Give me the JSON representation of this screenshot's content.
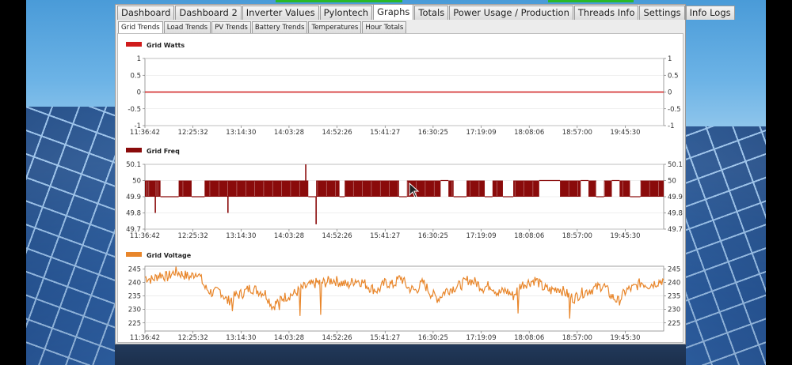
{
  "tabs": [
    {
      "label": "Dashboard",
      "active": false
    },
    {
      "label": "Dashboard 2",
      "active": false
    },
    {
      "label": "Inverter Values",
      "active": false
    },
    {
      "label": "Pylontech",
      "active": false
    },
    {
      "label": "Graphs",
      "active": true
    },
    {
      "label": "Totals",
      "active": false
    },
    {
      "label": "Power Usage / Production",
      "active": false
    },
    {
      "label": "Threads Info",
      "active": false
    },
    {
      "label": "Settings",
      "active": false
    },
    {
      "label": "Info Logs",
      "active": false
    }
  ],
  "subtabs": [
    {
      "label": "Grid Trends",
      "active": true
    },
    {
      "label": "Load Trends",
      "active": false
    },
    {
      "label": "PV Trends",
      "active": false
    },
    {
      "label": "Battery Trends",
      "active": false
    },
    {
      "label": "Temperatures",
      "active": false
    },
    {
      "label": "Hour Totals",
      "active": false
    }
  ],
  "colors": {
    "grid_watts": "#d01c1c",
    "grid_freq": "#8a0b0b",
    "grid_voltage": "#e8862b"
  },
  "chart_data": [
    {
      "type": "line",
      "legend": "Grid Watts",
      "color": "#d01c1c",
      "x_ticks": [
        "11:36:42",
        "12:25:32",
        "13:14:30",
        "14:03:28",
        "14:52:26",
        "15:41:27",
        "16:30:25",
        "17:19:09",
        "18:08:06",
        "18:57:00",
        "19:45:30"
      ],
      "y_ticks": [
        "1",
        "0.5",
        "0",
        "-0.5",
        "-1"
      ],
      "ylim": [
        -1,
        1
      ],
      "series": [
        {
          "name": "Grid Watts",
          "values": [
            0,
            0,
            0,
            0,
            0,
            0,
            0,
            0,
            0,
            0,
            0
          ]
        }
      ]
    },
    {
      "type": "line",
      "legend": "Grid Freq",
      "color": "#8a0b0b",
      "x_ticks": [
        "11:36:42",
        "12:25:32",
        "13:14:30",
        "14:03:28",
        "14:52:26",
        "15:41:27",
        "16:30:25",
        "17:19:09",
        "18:08:06",
        "18:57:00",
        "19:45:30"
      ],
      "y_ticks": [
        "50.1",
        "50",
        "49.9",
        "49.8",
        "49.7"
      ],
      "ylim": [
        49.7,
        50.1
      ],
      "oscillation_band": [
        49.9,
        50.0
      ],
      "band_gaps": [
        [
          0.03,
          0.065
        ],
        [
          0.09,
          0.115
        ],
        [
          0.315,
          0.33
        ],
        [
          0.375,
          0.385
        ],
        [
          0.49,
          0.505
        ],
        [
          0.57,
          0.585
        ],
        [
          0.595,
          0.62
        ],
        [
          0.655,
          0.67
        ],
        [
          0.69,
          0.71
        ],
        [
          0.76,
          0.8
        ],
        [
          0.84,
          0.855
        ],
        [
          0.87,
          0.885
        ],
        [
          0.9,
          0.915
        ],
        [
          0.935,
          0.955
        ]
      ],
      "dips": [
        {
          "x": 0.02,
          "y": 49.8
        },
        {
          "x": 0.16,
          "y": 49.8
        },
        {
          "x": 0.33,
          "y": 49.73
        }
      ],
      "spikes": [
        {
          "x": 0.31,
          "y": 50.1
        }
      ]
    },
    {
      "type": "line",
      "legend": "Grid Voltage",
      "color": "#e8862b",
      "x_ticks": [
        "11:36:42",
        "12:25:32",
        "13:14:30",
        "14:03:28",
        "14:52:26",
        "15:41:27",
        "16:30:25",
        "17:19:09",
        "18:08:06",
        "18:57:00",
        "19:45:30"
      ],
      "y_ticks": [
        "245",
        "240",
        "235",
        "230",
        "225"
      ],
      "ylim": [
        222,
        246
      ],
      "series": [
        {
          "name": "Grid Voltage",
          "values": [
            242,
            241,
            243,
            242,
            244,
            243,
            242,
            244,
            238,
            236,
            237,
            233,
            235,
            236,
            238,
            237,
            236,
            231,
            234,
            235,
            236,
            238,
            239,
            240,
            240,
            241,
            240,
            239,
            241,
            240,
            238,
            237,
            240,
            239,
            242,
            238,
            237,
            240,
            236,
            234,
            237,
            238,
            239,
            241,
            240,
            238,
            239,
            236,
            237,
            235,
            239,
            240,
            241,
            238,
            237,
            238,
            236,
            234,
            236,
            237,
            238,
            239,
            235,
            233,
            237,
            238,
            240,
            239,
            240,
            241
          ]
        }
      ]
    }
  ]
}
